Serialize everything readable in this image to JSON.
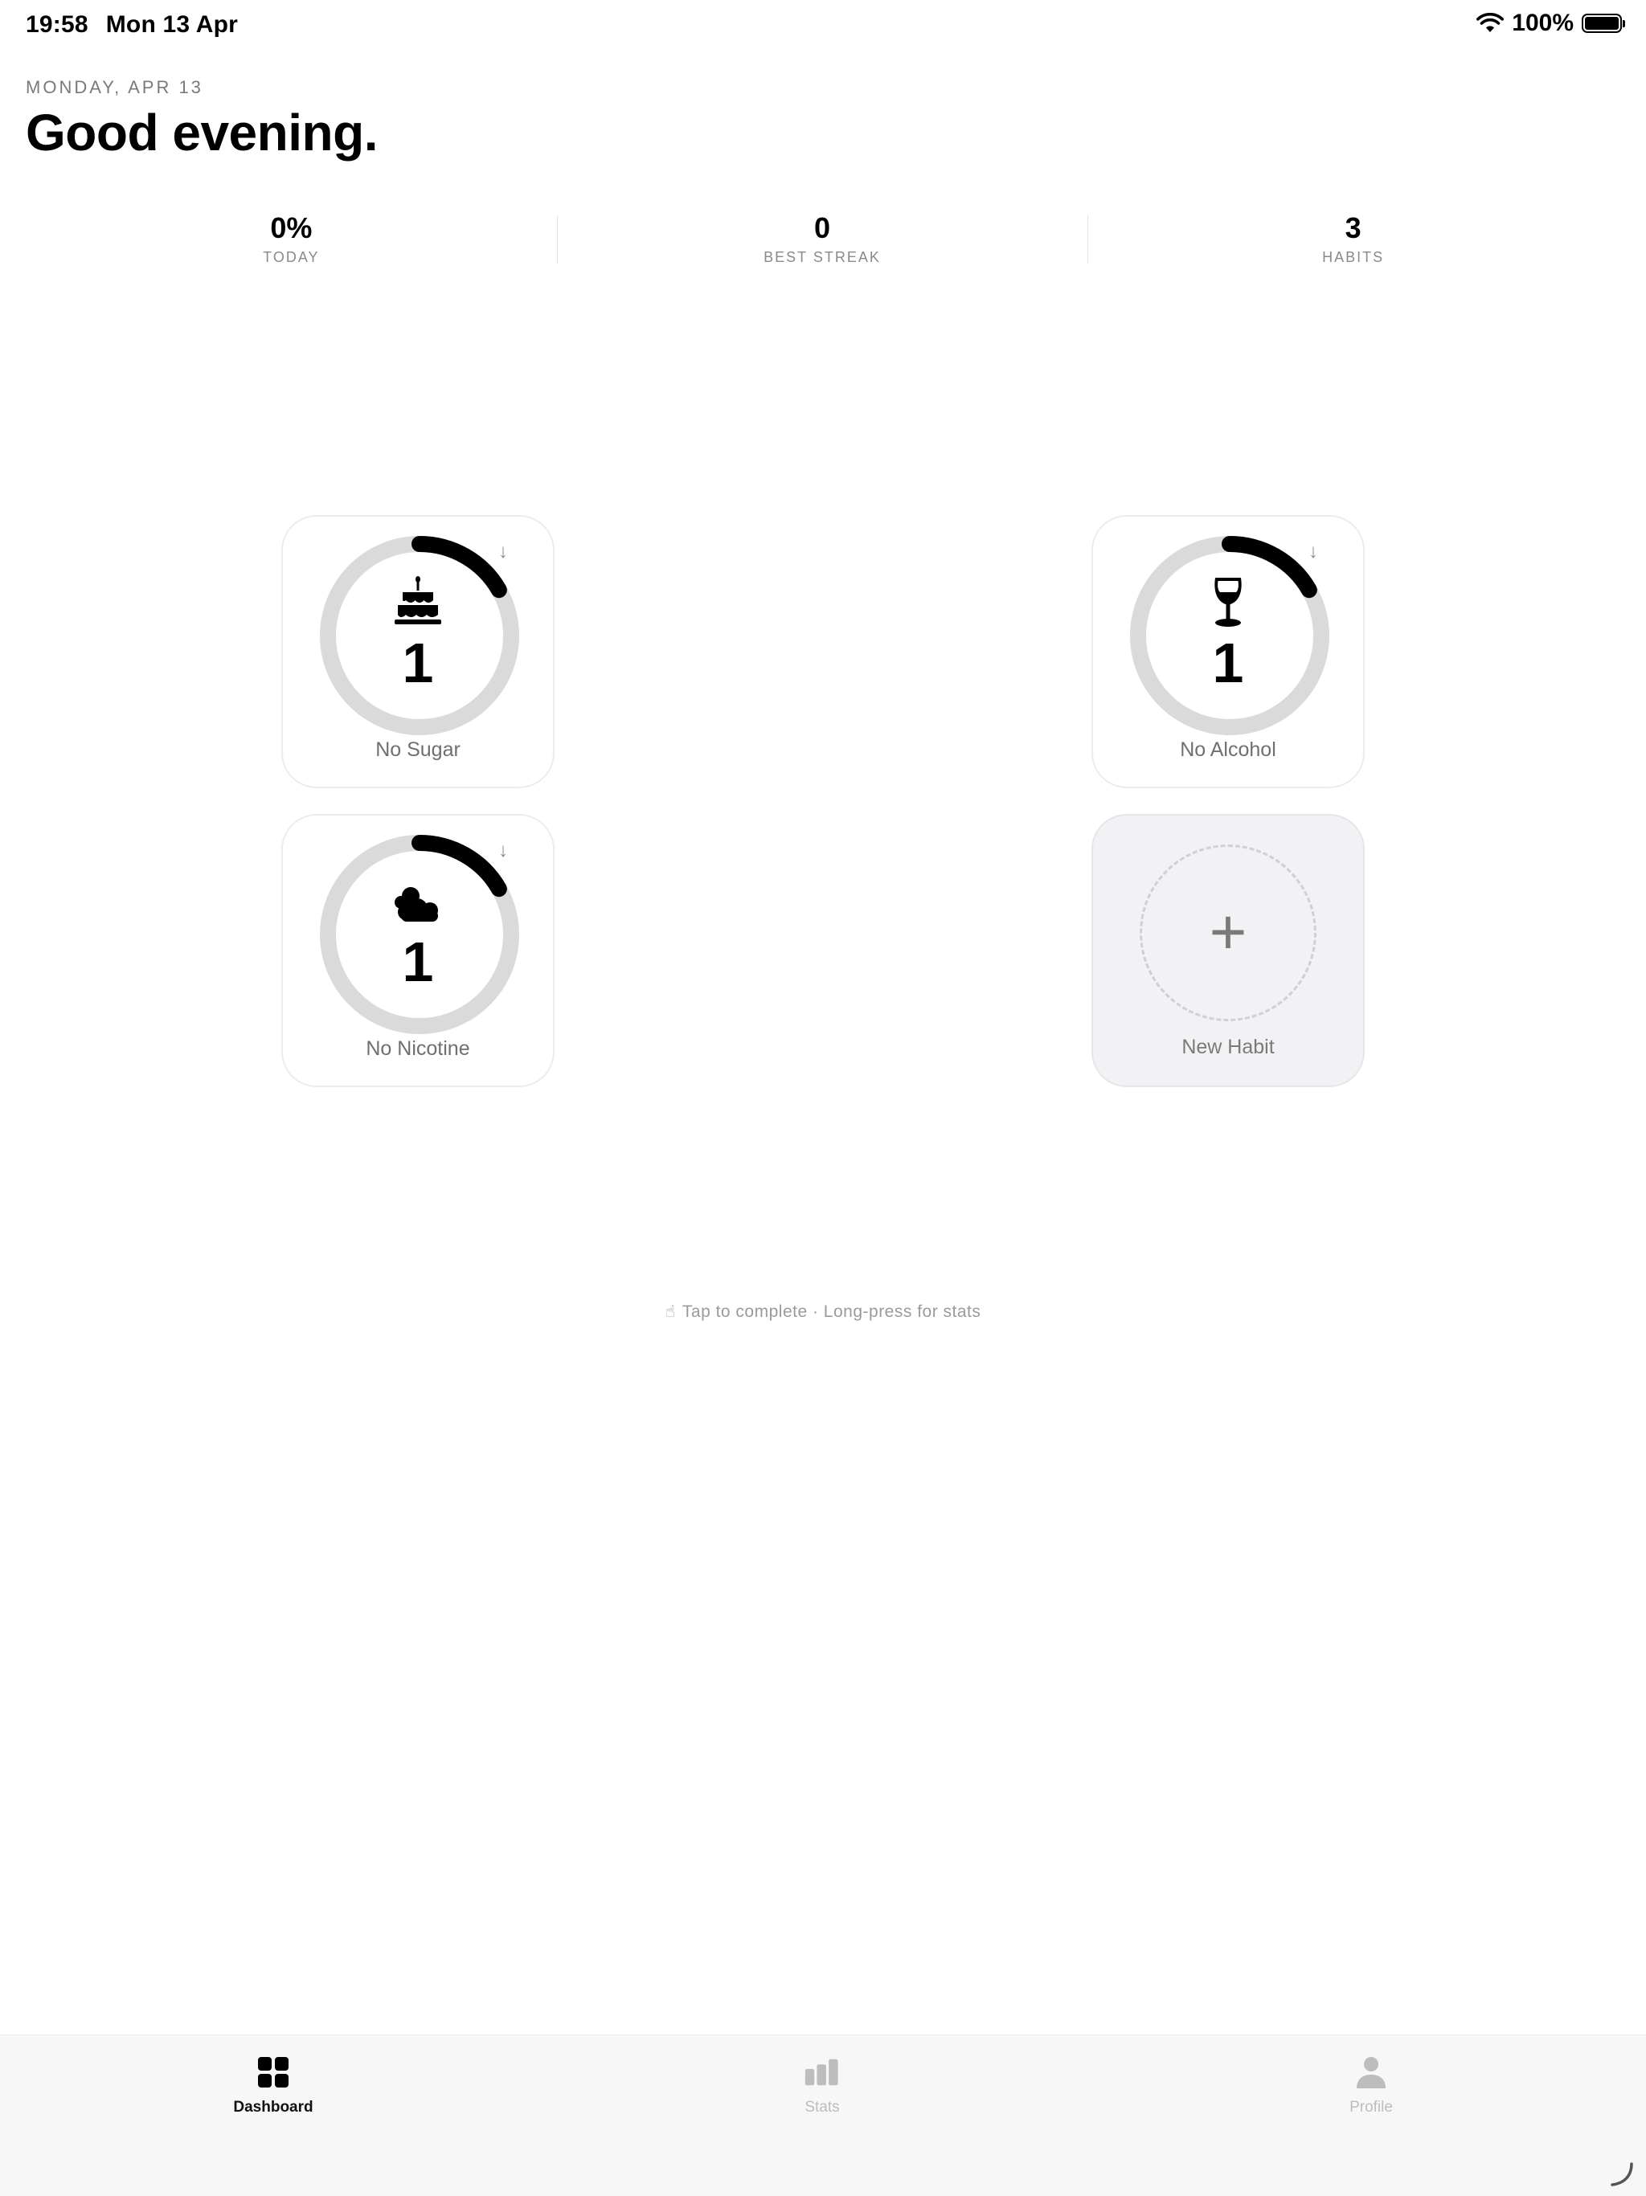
{
  "status_bar": {
    "time": "19:58",
    "date": "Mon 13 Apr",
    "battery": "100%"
  },
  "header": {
    "date_label": "MONDAY, APR 13",
    "greeting": "Good evening."
  },
  "stats": [
    {
      "value": "0%",
      "label": "TODAY"
    },
    {
      "value": "0",
      "label": "BEST STREAK"
    },
    {
      "value": "3",
      "label": "HABITS"
    }
  ],
  "habits": [
    {
      "name": "No Sugar",
      "count": "1",
      "icon": "cake-icon",
      "progress": 0.167
    },
    {
      "name": "No Alcohol",
      "count": "1",
      "icon": "wine-glass-icon",
      "progress": 0.167
    },
    {
      "name": "No Nicotine",
      "count": "1",
      "icon": "smoke-cloud-icon",
      "progress": 0.167
    }
  ],
  "new_habit": {
    "label": "New Habit"
  },
  "hint": "Tap to complete · Long-press for stats",
  "tabs": [
    {
      "label": "Dashboard",
      "icon": "grid-icon",
      "active": true
    },
    {
      "label": "Stats",
      "icon": "bar-chart-icon",
      "active": false
    },
    {
      "label": "Profile",
      "icon": "person-icon",
      "active": false
    }
  ]
}
